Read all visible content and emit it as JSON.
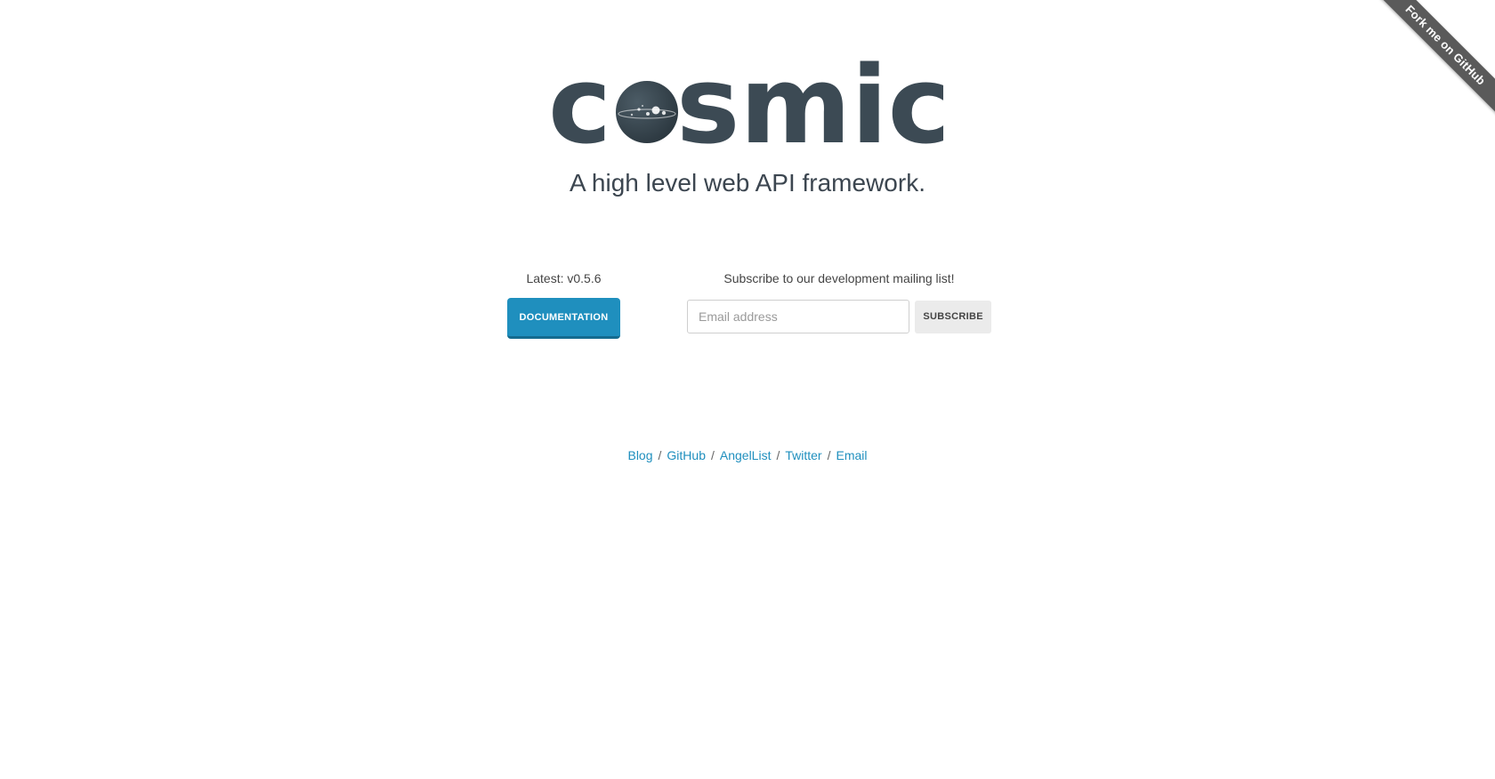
{
  "ribbon": {
    "label": "Fork me on GitHub"
  },
  "logo": {
    "text": "cosmic"
  },
  "tagline": "A high level web API framework.",
  "release": {
    "latest_label": "Latest: v0.5.6",
    "docs_button": "DOCUMENTATION"
  },
  "subscribe": {
    "label": "Subscribe to our development mailing list!",
    "email_placeholder": "Email address",
    "email_value": "",
    "button_label": "SUBSCRIBE"
  },
  "footer": {
    "links": [
      "Blog",
      "GitHub",
      "AngelList",
      "Twitter",
      "Email"
    ],
    "separator": "/"
  },
  "colors": {
    "accent": "#1f8fbe",
    "logo": "#3c4a54",
    "ribbon": "#5a5a5a"
  }
}
